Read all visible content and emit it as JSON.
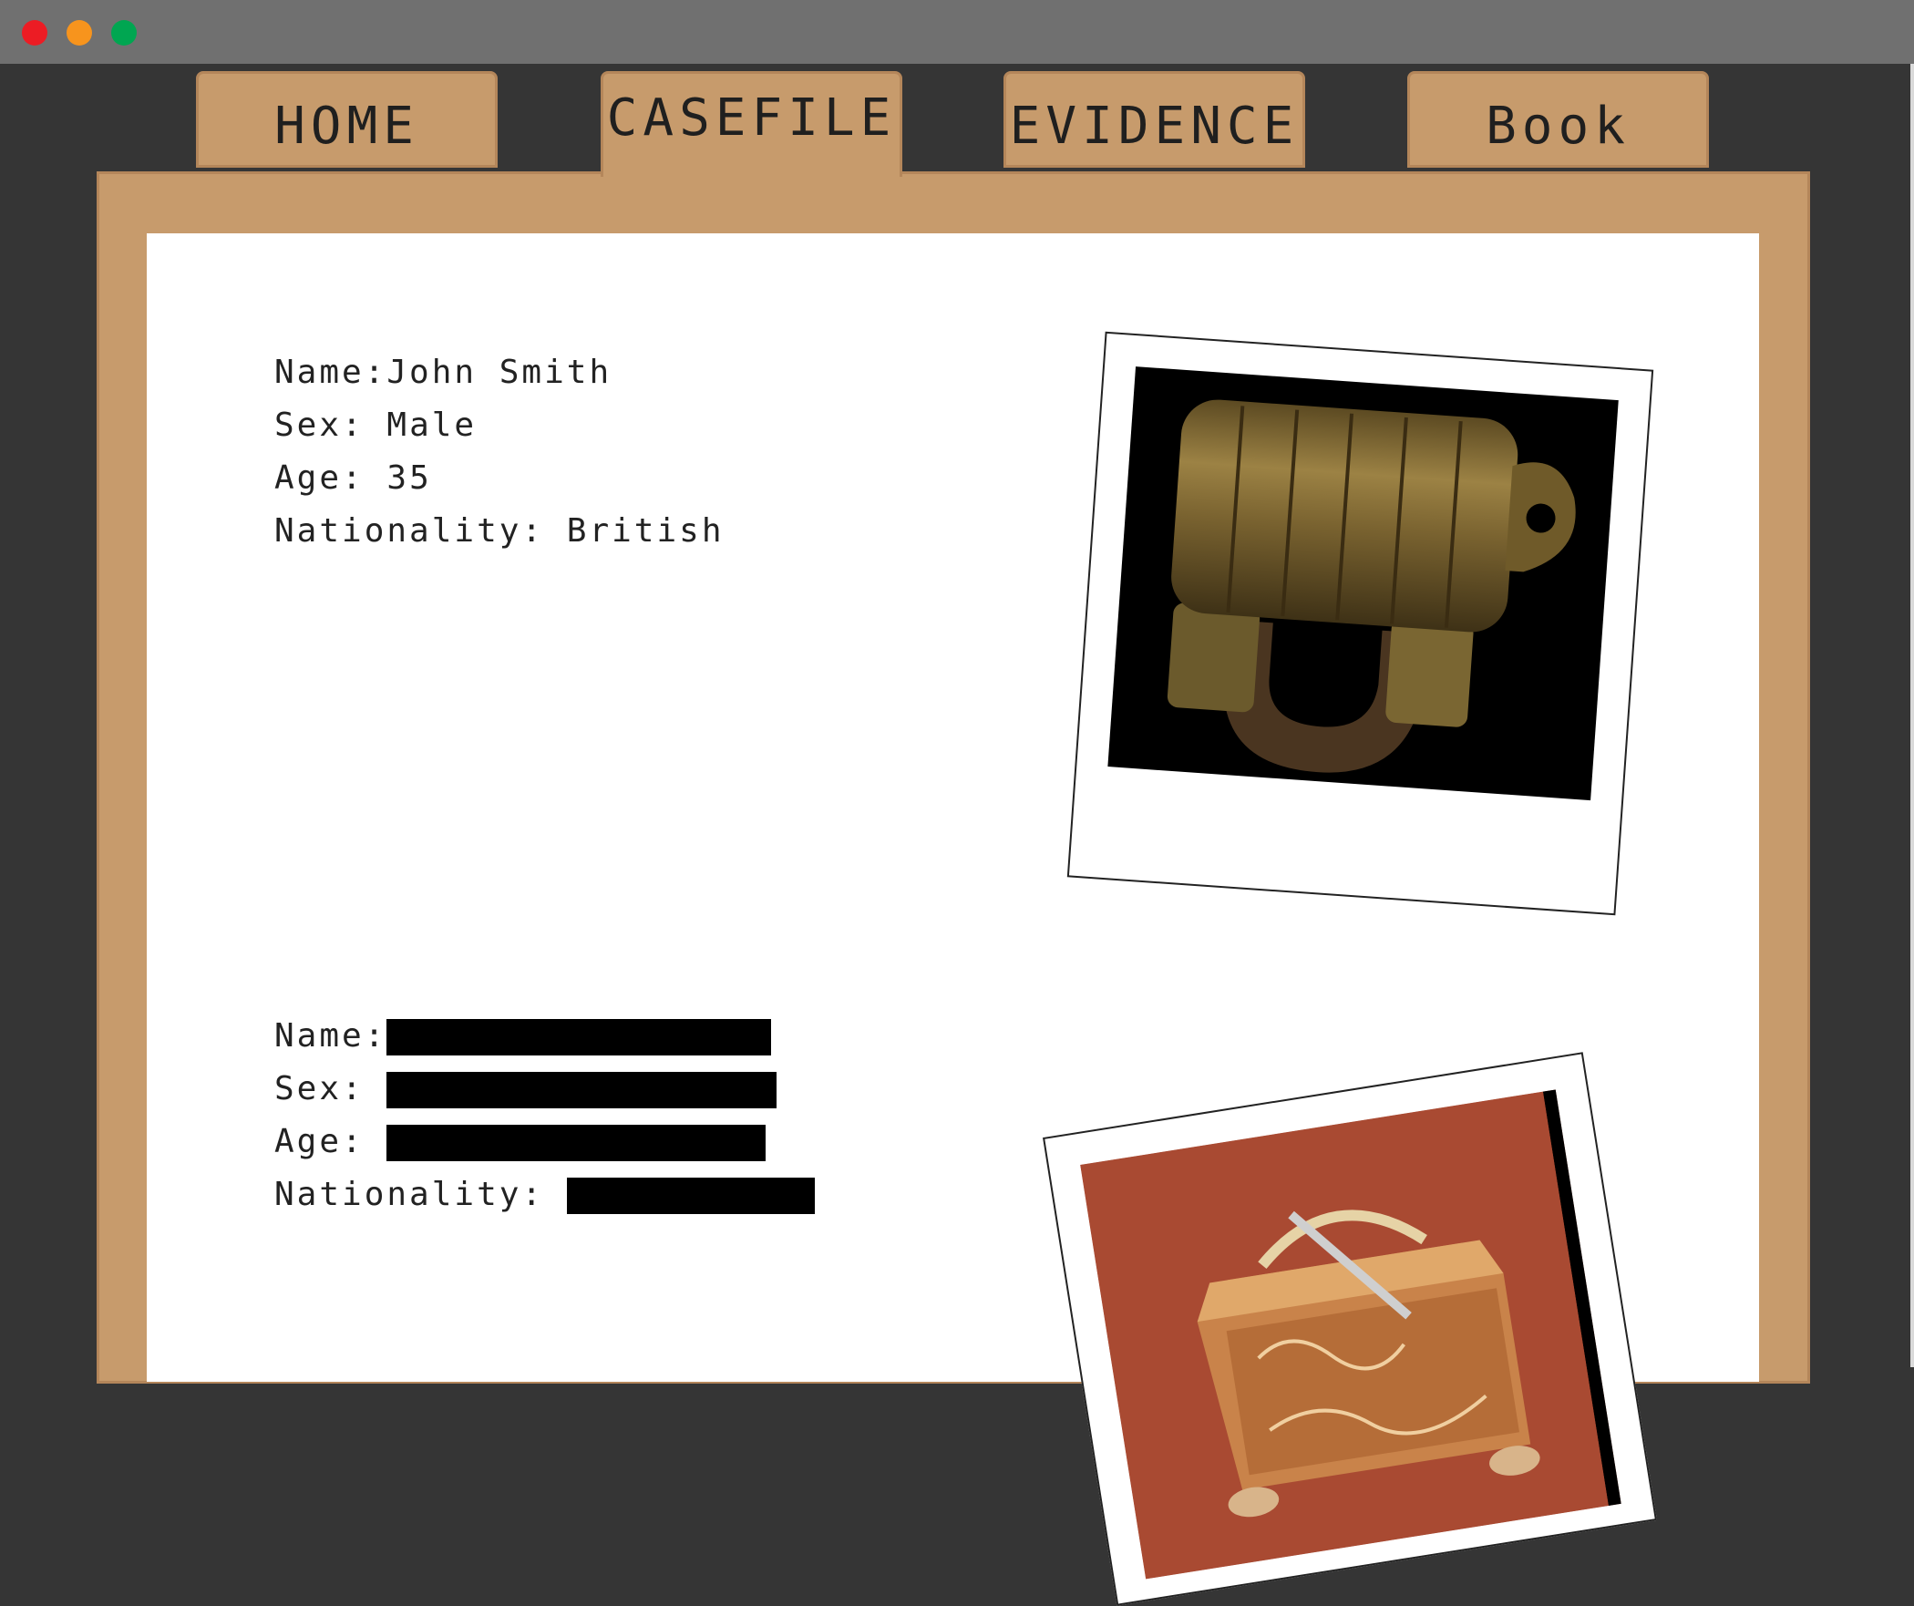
{
  "tabs": {
    "home": "HOME",
    "casefile": "CASEFILE",
    "evidence": "EVIDENCE",
    "book": "Book"
  },
  "casefile": {
    "profiles": [
      {
        "name_label": "Name:",
        "name_value": "John Smith",
        "sex_label": "Sex:",
        "sex_value": "Male",
        "age_label": "Age:",
        "age_value": "35",
        "nationality_label": "Nationality:",
        "nationality_value": "British",
        "photo": "brass-letter-combination-padlock"
      },
      {
        "name_label": "Name:",
        "sex_label": "Sex:",
        "age_label": "Age:",
        "nationality_label": "Nationality:",
        "redacted": true,
        "photo": "ornate-engraved-jewelry-box-with-key"
      }
    ]
  },
  "colors": {
    "window_bg": "#353535",
    "titlebar": "#707070",
    "folder": "#c79b6c",
    "folder_border": "#b4865a",
    "paper": "#ffffff",
    "redaction": "#000000",
    "close": "#ec1c24",
    "minimize": "#f7941d",
    "maximize": "#00a651"
  }
}
